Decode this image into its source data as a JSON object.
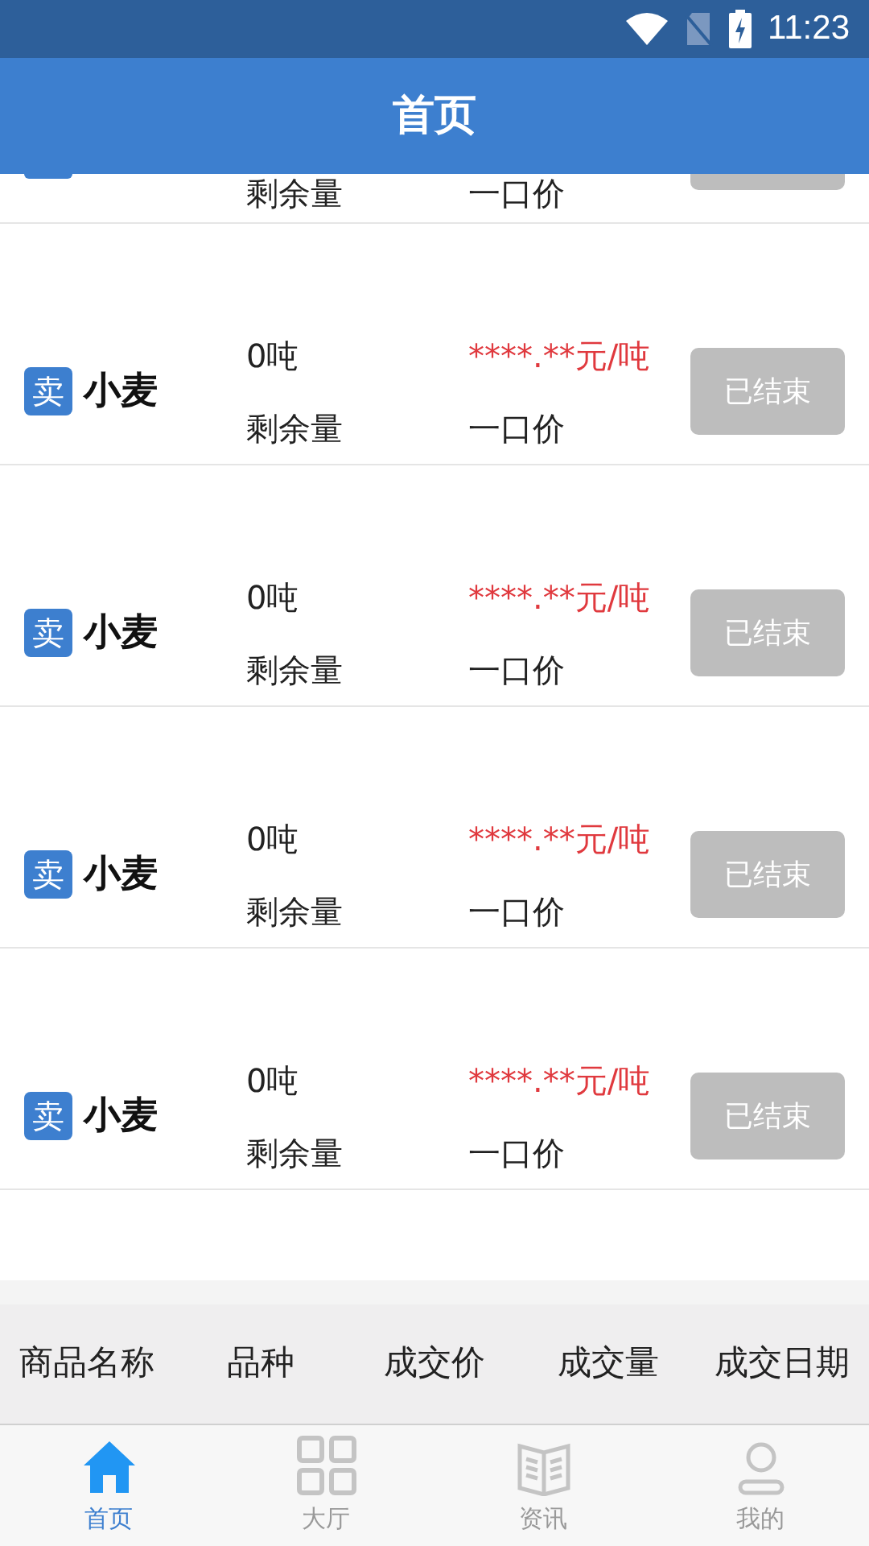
{
  "status_bar": {
    "time": "11:23"
  },
  "header": {
    "title": "首页"
  },
  "partial_row": {
    "remaining_label": "剩余量",
    "price_type": "一口价"
  },
  "rows": [
    {
      "badge": "卖",
      "name": "小麦",
      "quantity": "0吨",
      "remaining_label": "剩余量",
      "price": "****.**元/吨",
      "price_type": "一口价",
      "button": "已结束",
      "disabled": true
    },
    {
      "badge": "卖",
      "name": "小麦",
      "quantity": "0吨",
      "remaining_label": "剩余量",
      "price": "****.**元/吨",
      "price_type": "一口价",
      "button": "已结束",
      "disabled": true
    },
    {
      "badge": "卖",
      "name": "小麦",
      "quantity": "0吨",
      "remaining_label": "剩余量",
      "price": "****.**元/吨",
      "price_type": "一口价",
      "button": "已结束",
      "disabled": true
    },
    {
      "badge": "卖",
      "name": "小麦",
      "quantity": "0吨",
      "remaining_label": "剩余量",
      "price": "****.**元/吨",
      "price_type": "一口价",
      "button": "已结束",
      "disabled": true
    }
  ],
  "table": {
    "columns": [
      "商品名称",
      "品种",
      "成交价",
      "成交量",
      "成交日期"
    ]
  },
  "tab_bar": [
    {
      "kind": "home",
      "label": "首页",
      "selected": true
    },
    {
      "kind": "hall",
      "label": "大厅",
      "selected": false
    },
    {
      "kind": "news",
      "label": "资讯",
      "selected": false
    },
    {
      "kind": "profile",
      "label": "我的",
      "selected": false
    }
  ]
}
